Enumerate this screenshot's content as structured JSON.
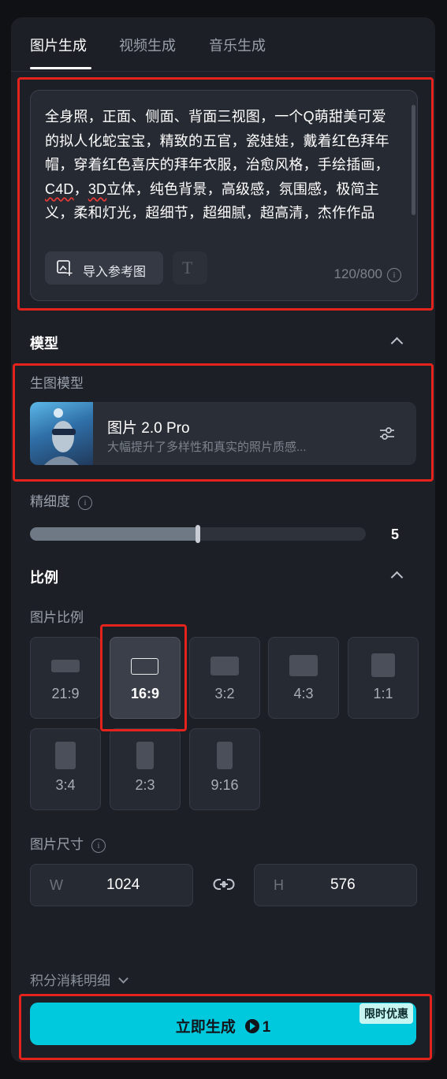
{
  "tabs": [
    {
      "label": "图片生成",
      "active": true
    },
    {
      "label": "视频生成",
      "active": false
    },
    {
      "label": "音乐生成",
      "active": false
    }
  ],
  "prompt": {
    "text_parts": [
      "全身照，正面、侧面、背面三视图，一个Q萌甜美可爱的拟人化蛇宝宝，精致的五官，瓷娃娃，戴着红色拜年帽，穿着红色喜庆的拜年衣服，治愈风格，手绘插画，",
      "C4D",
      "，",
      "3D",
      "立体，纯色背景，高级感，氛围感，极简主义，柔和灯光，超细节，超细腻，超高清，杰作作品"
    ],
    "import_ref_label": "导入参考图",
    "char_count": "120/800"
  },
  "model_section": {
    "title": "模型",
    "sub_label": "生图模型",
    "model_name": "图片 2.0 Pro",
    "model_desc": "大幅提升了多样性和真实的照片质感..."
  },
  "detail": {
    "label": "精细度",
    "value": "5",
    "fraction": 0.5
  },
  "ratio_section": {
    "title": "比例",
    "sub_label": "图片比例",
    "ratios": [
      "21:9",
      "16:9",
      "3:2",
      "4:3",
      "1:1",
      "3:4",
      "2:3",
      "9:16"
    ],
    "selected": "16:9"
  },
  "size": {
    "label": "图片尺寸",
    "w_key": "W",
    "w_value": "1024",
    "h_key": "H",
    "h_value": "576"
  },
  "points_label": "积分消耗明细",
  "generate": {
    "label": "立即生成",
    "cost": "1",
    "promo": "限时优惠"
  },
  "colors": {
    "accent": "#00c9de",
    "highlight": "#e3231c",
    "panel": "#1c1f26"
  }
}
